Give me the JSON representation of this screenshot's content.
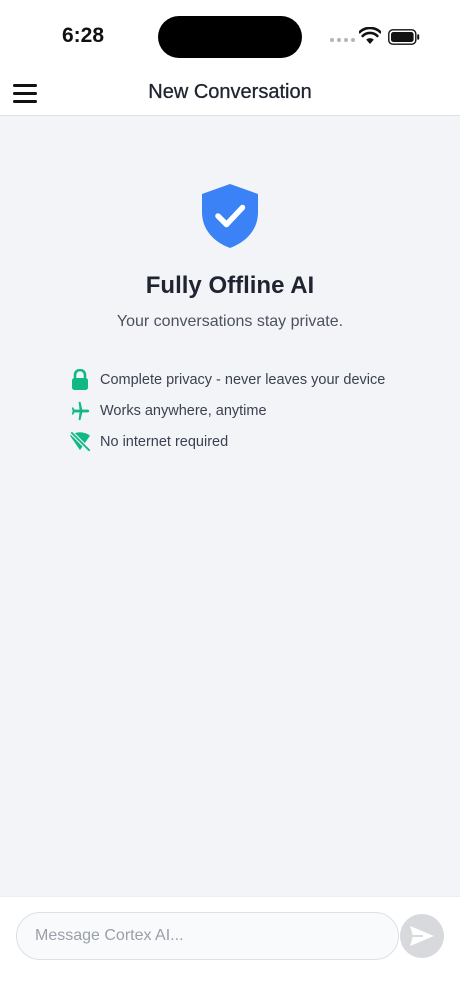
{
  "status_bar": {
    "time": "6:28",
    "icons": [
      "signal-icon",
      "wifi-icon",
      "battery-icon"
    ]
  },
  "nav": {
    "title": "New Conversation",
    "menu_icon": "hamburger-menu-icon"
  },
  "hero": {
    "icon": "shield-check-icon",
    "title": "Fully Offline AI",
    "subtitle": "Your conversations stay private."
  },
  "features": [
    {
      "icon": "lock-icon",
      "label": "Complete privacy - never leaves your device"
    },
    {
      "icon": "airplane-icon",
      "label": "Works anywhere, anytime"
    },
    {
      "icon": "wifi-off-icon",
      "label": "No internet required"
    }
  ],
  "composer": {
    "placeholder": "Message Cortex AI...",
    "value": "",
    "send_icon": "send-icon"
  },
  "colors": {
    "accent_blue": "#3b82f6",
    "feature_green": "#10b981",
    "background": "#f2f4f7",
    "send_disabled": "#d7d9dd"
  }
}
